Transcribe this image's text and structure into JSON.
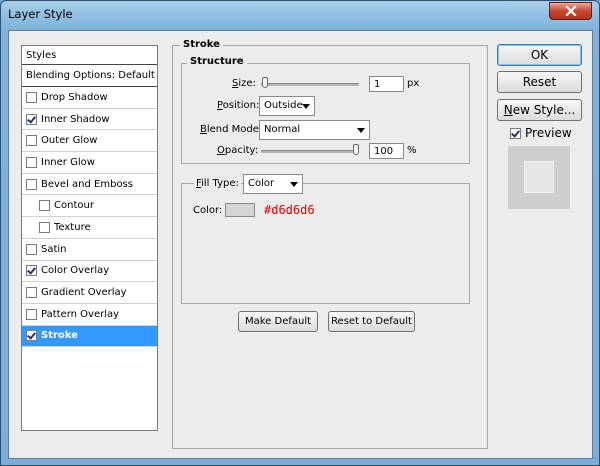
{
  "window": {
    "title": "Layer Style"
  },
  "styles_panel": {
    "header": "Styles",
    "blending_options": "Blending Options: Default",
    "items": [
      {
        "label": "Drop Shadow",
        "checked": false
      },
      {
        "label": "Inner Shadow",
        "checked": true
      },
      {
        "label": "Outer Glow",
        "checked": false
      },
      {
        "label": "Inner Glow",
        "checked": false
      },
      {
        "label": "Bevel and Emboss",
        "checked": false
      },
      {
        "label": "Contour",
        "checked": false
      },
      {
        "label": "Texture",
        "checked": false
      },
      {
        "label": "Satin",
        "checked": false
      },
      {
        "label": "Color Overlay",
        "checked": true
      },
      {
        "label": "Gradient Overlay",
        "checked": false
      },
      {
        "label": "Pattern Overlay",
        "checked": false
      },
      {
        "label": "Stroke",
        "checked": true
      }
    ]
  },
  "stroke": {
    "title": "Stroke",
    "structure_title": "Structure",
    "size": {
      "label": "Size:",
      "value": "1",
      "unit": "px",
      "slider_fraction": 0.01
    },
    "position": {
      "label": "Position:",
      "value": "Outside"
    },
    "blend_mode": {
      "label": "Blend Mode:",
      "value": "Normal"
    },
    "opacity": {
      "label": "Opacity:",
      "value": "100",
      "unit": "%",
      "slider_fraction": 1.0
    },
    "fill_type": {
      "label": "Fill Type:",
      "value": "Color"
    },
    "color": {
      "label": "Color:",
      "swatch": "#d6d6d6",
      "annotation": "#d6d6d6"
    },
    "make_default": "Make Default",
    "reset_to_default": "Reset to Default"
  },
  "buttons": {
    "ok": "OK",
    "reset": "Reset",
    "new_style": "New Style...",
    "preview_label": "Preview",
    "preview_checked": true
  }
}
